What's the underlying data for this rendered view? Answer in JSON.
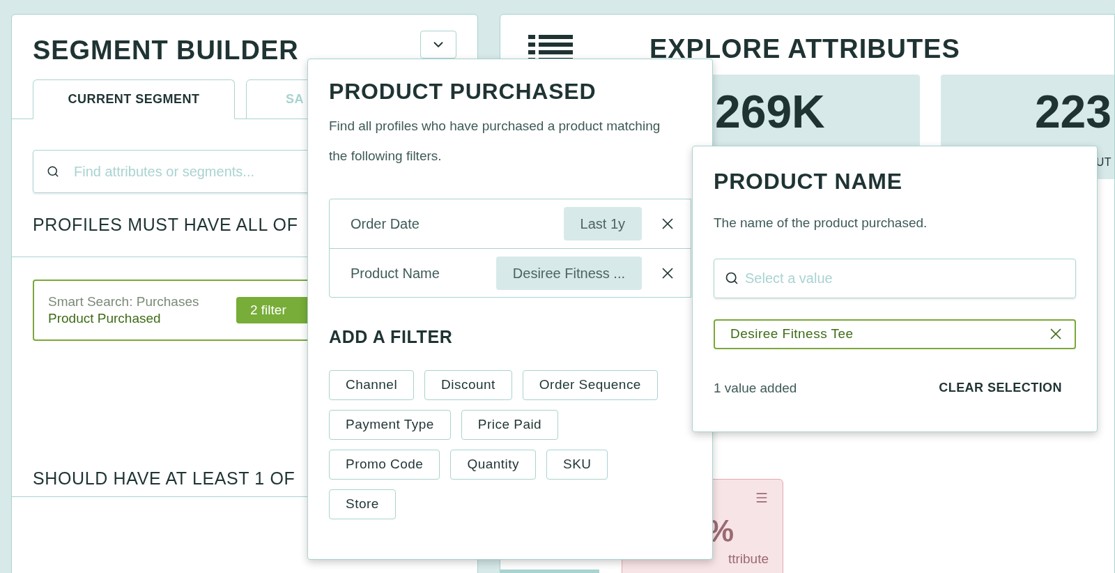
{
  "segment_builder": {
    "title": "SEGMENT BUILDER",
    "tabs": [
      {
        "label": "CURRENT SEGMENT",
        "selected": true
      },
      {
        "label": "SA",
        "selected": false
      }
    ],
    "search": {
      "placeholder": "Find attributes or segments..."
    },
    "must_heading": "PROFILES MUST HAVE ALL OF",
    "condition": {
      "source": "Smart Search: Purchases",
      "name": "Product Purchased",
      "badge": "2 filter"
    },
    "should_heading": "SHOULD HAVE AT LEAST 1 OF"
  },
  "explore": {
    "title": "EXPLORE ATTRIBUTES",
    "cards": [
      {
        "value": "269K"
      },
      {
        "value": "223",
        "label": "UT"
      }
    ],
    "attribute_card": {
      "value": "%",
      "label": "ttribute"
    }
  },
  "product_purchased": {
    "title": "PRODUCT PURCHASED",
    "description": "Find all profiles who have purchased a product matching the following filters.",
    "filters": [
      {
        "label": "Order Date",
        "value": "Last 1y"
      },
      {
        "label": "Product Name",
        "value": "Desiree Fitness ..."
      }
    ],
    "add_heading": "ADD A FILTER",
    "options": [
      "Channel",
      "Discount",
      "Order Sequence",
      "Payment Type",
      "Price Paid",
      "Promo Code",
      "Quantity",
      "SKU",
      "Store"
    ]
  },
  "product_name": {
    "title": "PRODUCT NAME",
    "description": "The name of the product purchased.",
    "search": {
      "placeholder": "Select a value"
    },
    "values": [
      "Desiree Fitness Tee"
    ],
    "count": "1 value added",
    "clear": "CLEAR SELECTION"
  }
}
